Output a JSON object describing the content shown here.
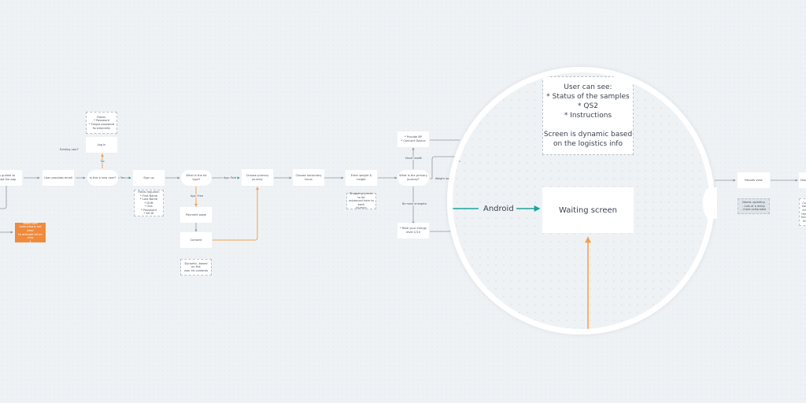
{
  "flow": {
    "nodes": {
      "guided": "User is guided to\ndownload the app",
      "provides_email": "User provides email",
      "new_user": "Is this a new user?",
      "fields_top": "Fields:\n* Password\n* Forgot password\nfunctionality",
      "log_in": "Log in",
      "sign_up": "Sign up",
      "fields_required": "Fields required:\n* First Name\n* Last Name\n* DOB\n* Sex\n* Password\n* Kit ID",
      "kit_type": "What is the kit type?",
      "payment_page": "Payment page",
      "consent": "Consent",
      "dynamic_note": "Dynamic, based on the\nuser kit contents",
      "primary_journey": "Choose primary\njourney",
      "secondary_focus": "Choose secondary\nfocus",
      "weight_height": "Enter weight & height",
      "shopping_note": "Shopping screen to be\nadvanced here to each\njourney",
      "which_primary": "What is the primary\njourney?",
      "provide_bp": "* Provide BP\n* Connect Device",
      "rate_energy": "* Rate your energy\nlevel 1/10",
      "orange_note": "Make sure\ninstructions are clear\nto activate kit on step\n1",
      "results_view": "Results view",
      "results_note": "Needs updating\n- Lots of a delay\n- more actionable",
      "next_partial": "Dash",
      "right_note_partial": "Con\ntake\nand\nthe s\nfocus\nlev"
    },
    "edge_labels": {
      "existing_user": "Existing user?",
      "no": "No",
      "yes": "Yes",
      "app_free": "App: Free",
      "app_paid": "App: Paid",
      "heart_health": "Heart health",
      "be_more_energetic": "Be more energetic",
      "weight_loss": "Weight loss"
    }
  },
  "magnifier": {
    "note": "User can see:\n* Status of the samples\n* QS2\n* Instructions\n\nScreen is dynamic based\non the logistics info",
    "waiting_screen": "Waiting screen",
    "android_label": "Android"
  },
  "colors": {
    "teal": "#1fa39a",
    "orange": "#f3a24f",
    "line": "#8d96a0"
  }
}
